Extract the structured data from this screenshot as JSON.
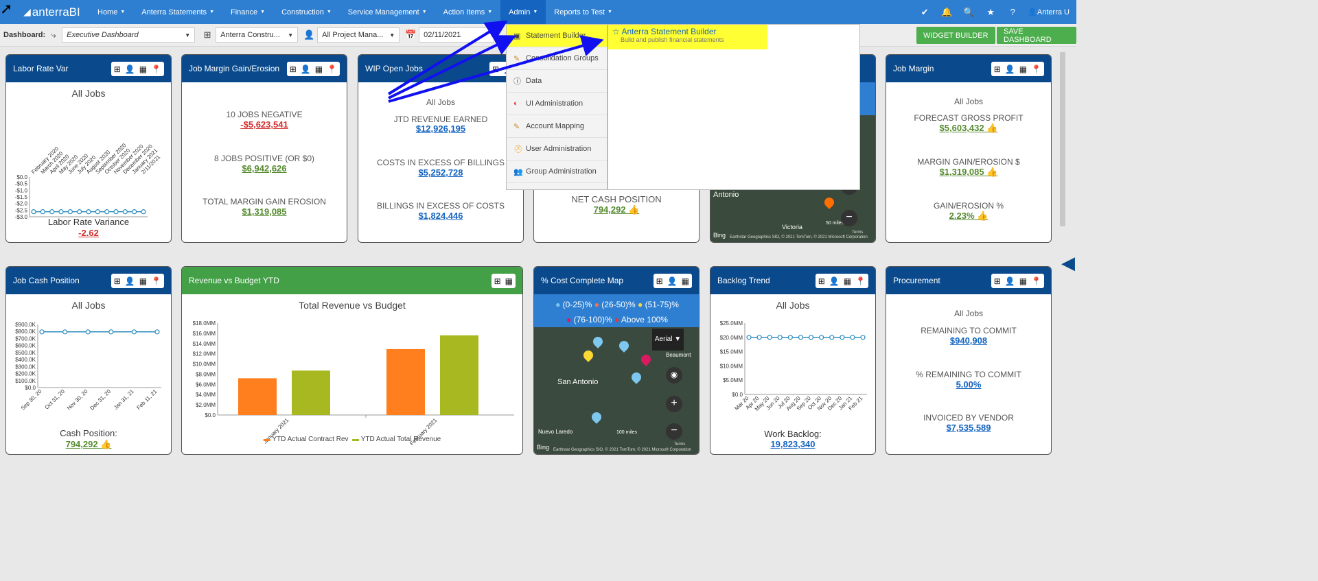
{
  "logo": "anterraBI",
  "nav": [
    {
      "label": "Home"
    },
    {
      "label": "Anterra Statements"
    },
    {
      "label": "Finance"
    },
    {
      "label": "Construction"
    },
    {
      "label": "Service Management"
    },
    {
      "label": "Action Items"
    },
    {
      "label": "Admin"
    },
    {
      "label": "Reports to Test"
    }
  ],
  "user": "Anterra U",
  "dashbar": {
    "label": "Dashboard:",
    "dashboard": "Executive Dashboard",
    "company": "Anterra Constru...",
    "manager": "All Project Mana...",
    "date": "02/11/2021",
    "widget_builder": "WIDGET BUILDER",
    "save_dashboard": "SAVE DASHBOARD"
  },
  "admin_menu": [
    {
      "label": "Statement Builder"
    },
    {
      "label": "Consolidation Groups"
    },
    {
      "label": "Data"
    },
    {
      "label": "UI Administration"
    },
    {
      "label": "Account Mapping"
    },
    {
      "label": "User Administration"
    },
    {
      "label": "Group Administration"
    }
  ],
  "submenu": {
    "title": "Anterra Statement Builder",
    "desc": "Build and publish financial statements"
  },
  "cards": {
    "labor": {
      "title": "Labor Rate Var",
      "sub": "All Jobs",
      "footer_label": "Labor Rate Variance",
      "footer_value": "-2.62"
    },
    "margin_ge": {
      "title": "Job Margin Gain/Erosion",
      "l1": "10 JOBS NEGATIVE",
      "v1": "-$5,623,541",
      "l2": "8 JOBS POSITIVE (OR $0)",
      "v2": "$6,942,626",
      "l3": "TOTAL MARGIN GAIN EROSION",
      "v3": "$1,319,085"
    },
    "wip": {
      "title": "WIP Open Jobs",
      "sub": "All Jobs",
      "l1": "JTD REVENUE EARNED",
      "v1": "$12,926,195",
      "l2": "COSTS IN EXCESS OF BILLINGS",
      "v2": "$5,252,728",
      "l3": "BILLINGS IN EXCESS OF COSTS",
      "v3": "$1,824,446"
    },
    "cash_partial": {
      "l1": "NET CASH POSITION",
      "v1": "794,292"
    },
    "map1": {
      "city": "Antonio",
      "scale": "50 miles",
      "credit": "Earthstar Geographics SIO, © 2021 TomTom, © 2021 Microsoft Corporation",
      "city2": "Victoria",
      "terms": "Terms",
      "bing": "Bing"
    },
    "job_margin": {
      "title": "Job Margin",
      "sub": "All Jobs",
      "l1": "FORECAST GROSS PROFIT",
      "v1": "$5,603,432",
      "l2": "MARGIN GAIN/EROSION $",
      "v2": "$1,319,085",
      "l3": "GAIN/EROSION %",
      "v3": "2.23%"
    },
    "job_cash": {
      "title": "Job Cash Position",
      "sub": "All Jobs",
      "footer_label": "Cash Position:",
      "footer_value": "794,292"
    },
    "rev_budget": {
      "title": "Revenue vs Budget YTD",
      "chart_title": "Total Revenue vs Budget",
      "legend1": "YTD Actual Contract Rev",
      "legend2": "YTD Actual Total Revenue"
    },
    "cost_map": {
      "title": "% Cost Complete Map",
      "leg1": "(0-25)%",
      "leg2": "(26-50)%",
      "leg3": "(51-75)%",
      "leg4": "(76-100)%",
      "leg5": "Above 100%",
      "aerial": "Aerial",
      "city": "San Antonio",
      "city2": "Beaumont",
      "city3": "Nuevo Laredo",
      "scale": "100 miles",
      "credit": "Earthstar Geographics SIO, © 2021 TomTom, © 2021 Microsoft Corporation",
      "terms": "Terms",
      "bing": "Bing"
    },
    "backlog": {
      "title": "Backlog Trend",
      "sub": "All Jobs",
      "footer_label": "Work Backlog:",
      "footer_value": "19,823,340"
    },
    "procurement": {
      "title": "Procurement",
      "sub": "All Jobs",
      "l1": "REMAINING TO COMMIT",
      "v1": "$940,908",
      "l2": "% REMAINING TO COMMIT",
      "v2": "5.00%",
      "l3": "INVOICED BY VENDOR",
      "v3": "$7,535,589"
    }
  },
  "chart_data": [
    {
      "type": "line",
      "name": "labor",
      "categories": [
        "February 2020",
        "March 2020",
        "April 2020",
        "May 2020",
        "June 2020",
        "July 2020",
        "August 2020",
        "September 2020",
        "October 2020",
        "November 2020",
        "December 2020",
        "January 2021",
        "2/11/2021"
      ],
      "values": [
        -2.62,
        -2.62,
        -2.62,
        -2.62,
        -2.62,
        -2.62,
        -2.62,
        -2.62,
        -2.62,
        -2.62,
        -2.62,
        -2.62,
        -2.62
      ],
      "yticks": [
        "$0.0",
        "-$0.5",
        "-$1.0",
        "-$1.5",
        "-$2.0",
        "-$2.5",
        "-$3.0"
      ],
      "ylim": [
        -3,
        0
      ]
    },
    {
      "type": "line",
      "name": "cash",
      "categories": [
        "Sep 30, 20",
        "Oct 31, 20",
        "Nov 30, 20",
        "Dec 31, 20",
        "Jan 31, 21",
        "Feb 11, 21"
      ],
      "values": [
        794292,
        794292,
        794292,
        794292,
        794292,
        794292
      ],
      "yticks": [
        "$900.0K",
        "$800.0K",
        "$700.0K",
        "$600.0K",
        "$500.0K",
        "$400.0K",
        "$300.0K",
        "$200.0K",
        "$100.0K",
        "$0.0"
      ],
      "ylim": [
        0,
        900000
      ]
    },
    {
      "type": "bar",
      "name": "revenue",
      "categories": [
        "January 2021",
        "February 2021"
      ],
      "series": [
        {
          "name": "YTD Actual Contract Rev",
          "values": [
            7200000,
            12900000
          ]
        },
        {
          "name": "YTD Actual Total Revenue",
          "values": [
            8700000,
            15600000
          ]
        }
      ],
      "yticks": [
        "$18.0MM",
        "$16.0MM",
        "$14.0MM",
        "$12.0MM",
        "$10.0MM",
        "$8.0MM",
        "$6.0MM",
        "$4.0MM",
        "$2.0MM",
        "$0.0"
      ],
      "ylim": [
        0,
        18000000
      ]
    },
    {
      "type": "line",
      "name": "backlog",
      "categories": [
        "Mar 20",
        "Apr 20",
        "May 20",
        "Jun 20",
        "Jul 20",
        "Aug 20",
        "Sep 20",
        "Oct 20",
        "Nov 20",
        "Dec 20",
        "Jan 21",
        "Feb 21"
      ],
      "values": [
        20000000,
        20000000,
        20000000,
        20000000,
        20000000,
        20000000,
        20000000,
        20000000,
        20000000,
        20000000,
        20000000,
        20000000
      ],
      "yticks": [
        "$25.0MM",
        "$20.0MM",
        "$15.0MM",
        "$10.0MM",
        "$5.0MM",
        "$0.0"
      ],
      "ylim": [
        0,
        25000000
      ]
    }
  ],
  "colors": {
    "nav": "#2e7fd1",
    "cardHead": "#0a4a8c",
    "green": "#43a047",
    "highlight": "#ffff33",
    "bar1": "#ff7f1e",
    "bar2": "#a8b820",
    "line": "#2b8cbe"
  }
}
